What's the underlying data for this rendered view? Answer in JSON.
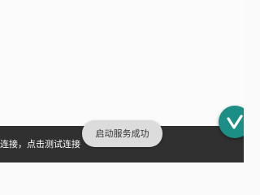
{
  "snackbar": {
    "message": "连接，点击测试连接"
  },
  "toast": {
    "message": "启动服务成功"
  },
  "fab": {
    "icon": "check-v-icon",
    "color": "#1b8f86"
  },
  "colors": {
    "background": "#fbfbfb",
    "snackbar": "#303030",
    "toast": "#dcdcdc"
  }
}
